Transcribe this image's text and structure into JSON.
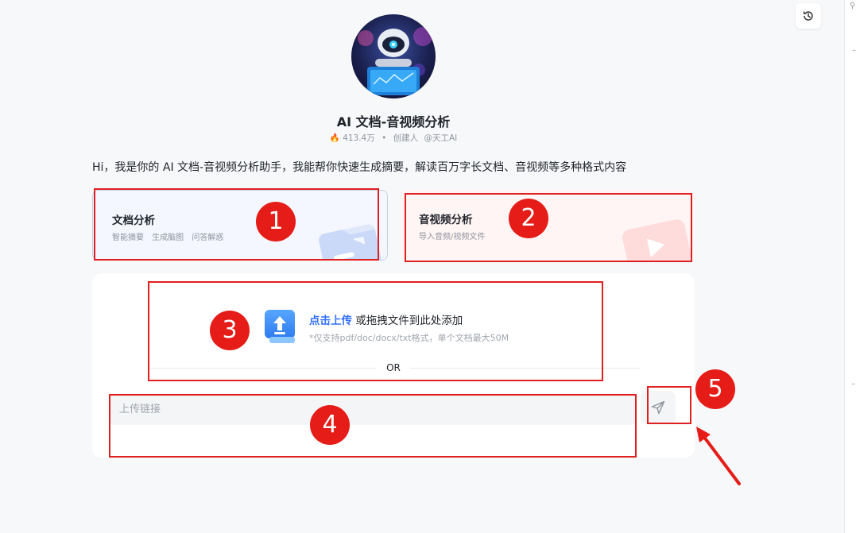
{
  "bot": {
    "title": "AI 文档-音视频分析",
    "usage": "413.4万",
    "separator": "•",
    "creator_label": "创建人",
    "creator": "@天工AI",
    "intro": "Hi，我是你的 AI 文档-音视频分析助手，我能帮你快速生成摘要，解读百万字长文档、音视频等多种格式内容"
  },
  "cards": [
    {
      "title": "文档分析",
      "tags": [
        "智能摘要",
        "生成脑图",
        "问答解惑"
      ]
    },
    {
      "title": "音视频分析",
      "tags": [
        "导入音频/视频文件"
      ]
    }
  ],
  "upload": {
    "link_text": "点击上传",
    "rest_text": "或拖拽文件到此处添加",
    "hint": "*仅支持pdf/doc/docx/txt格式，单个文档最大50M",
    "or_text": "OR"
  },
  "link_input": {
    "placeholder": "上传链接",
    "value": ""
  },
  "annotations": [
    "1",
    "2",
    "3",
    "4",
    "5"
  ],
  "icons": {
    "history": "history-icon",
    "send": "send-icon",
    "upload": "upload-file-icon",
    "fire": "fire-icon"
  },
  "colors": {
    "accent": "#3370ff",
    "annotation": "#e51c17",
    "background": "#f7f8fa"
  }
}
